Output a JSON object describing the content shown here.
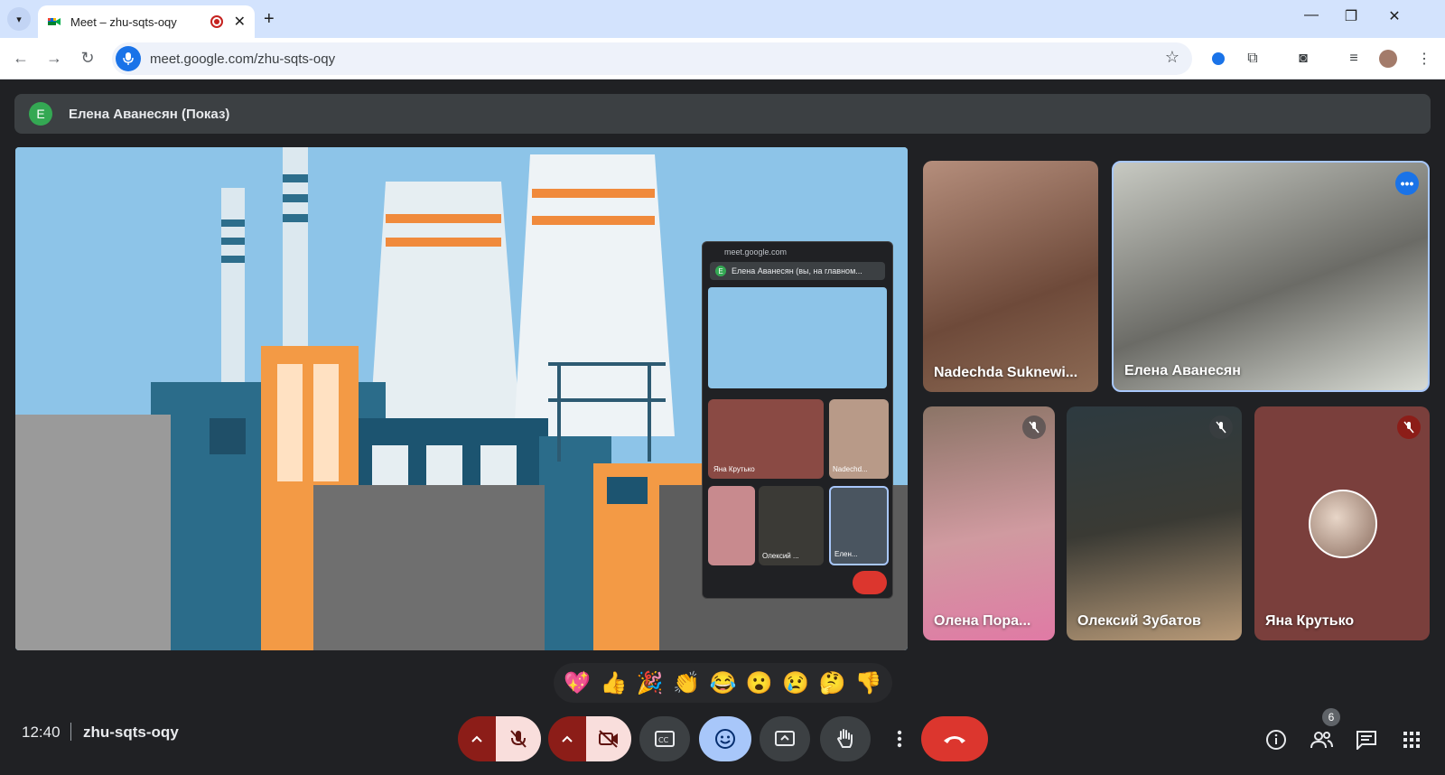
{
  "browser": {
    "tab_title": "Meet – zhu-sqts-oqy",
    "url": "meet.google.com/zhu-sqts-oqy"
  },
  "meet": {
    "presenter_initial": "E",
    "presenter_label": "Елена Аванесян (Показ)",
    "pip": {
      "site": "meet.google.com",
      "header": "Елена Аванесян (вы, на главном...",
      "tile_1": "Яна Крутько",
      "tile_2": "Nadechd...",
      "tile_3": "Олексий ...",
      "tile_4": "Елен..."
    },
    "participants": [
      {
        "name": "Nadechda Suknewi..."
      },
      {
        "name": "Елена Аванесян"
      },
      {
        "name": "Олена Пора..."
      },
      {
        "name": "Олексий Зубатов"
      },
      {
        "name": "Яна Крутько"
      }
    ],
    "reactions": [
      "💖",
      "👍",
      "🎉",
      "👏",
      "😂",
      "😮",
      "😢",
      "🤔",
      "👎"
    ],
    "clock": "12:40",
    "meeting_code": "zhu-sqts-oqy",
    "people_count": "6"
  },
  "colors": {
    "meet_bg": "#202124",
    "hangup": "#dc362e",
    "accent_blue": "#1a73e8"
  }
}
